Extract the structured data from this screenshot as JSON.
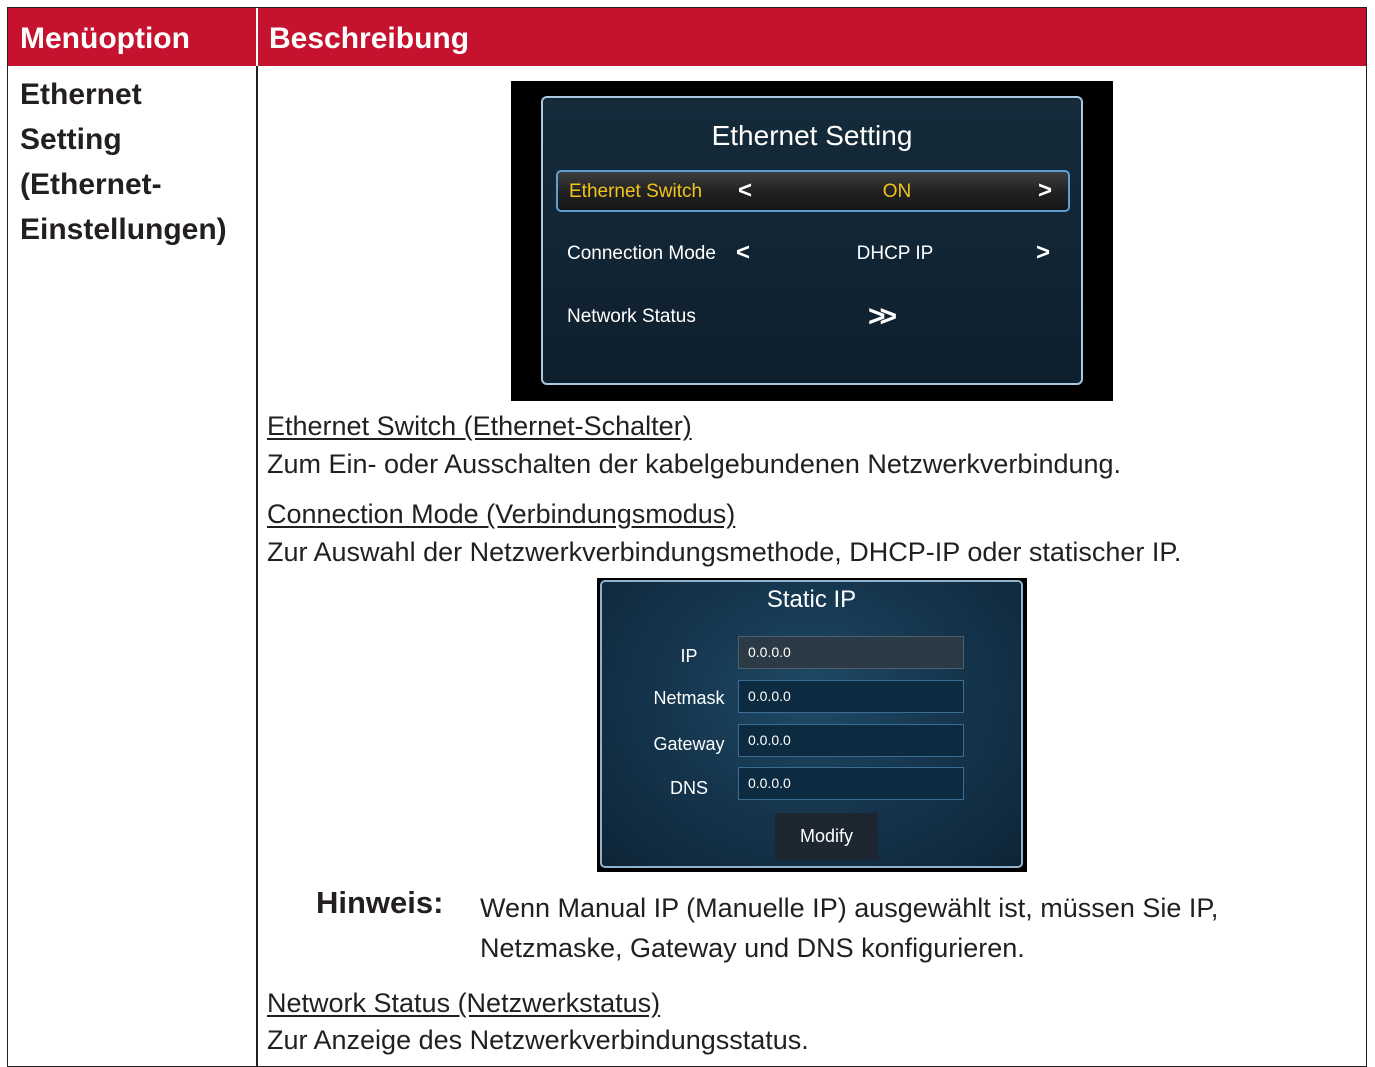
{
  "table": {
    "header": {
      "col1": "Menüoption",
      "col2": "Beschreibung"
    },
    "menu_option": {
      "line1": "Ethernet",
      "line2": "Setting",
      "line3": "(Ethernet-",
      "line4": "Einstellungen)"
    }
  },
  "ethernet_panel": {
    "title": "Ethernet Setting",
    "rows": [
      {
        "label": "Ethernet Switch",
        "value": "ON",
        "left": "<",
        "right": ">"
      },
      {
        "label": "Connection Mode",
        "value": "DHCP IP",
        "left": "<",
        "right": ">"
      },
      {
        "label": "Network Status",
        "value": ">>"
      }
    ]
  },
  "sections": {
    "ethernet_switch": {
      "title": "Ethernet Switch (Ethernet-Schalter)",
      "text": "Zum Ein- oder Ausschalten der kabelgebundenen Netzwerkverbindung."
    },
    "connection_mode": {
      "title": "Connection Mode (Verbindungsmodus)",
      "text": "Zur Auswahl der Netzwerkverbindungsmethode, DHCP-IP oder statischer IP."
    },
    "network_status": {
      "title": "Network Status (Netzwerkstatus)",
      "text": "Zur Anzeige des Netzwerkverbindungsstatus."
    }
  },
  "static_ip_panel": {
    "title": "Static IP",
    "fields": [
      {
        "label": "IP",
        "value": "0.0.0.0"
      },
      {
        "label": "Netmask",
        "value": "0.0.0.0"
      },
      {
        "label": "Gateway",
        "value": "0.0.0.0"
      },
      {
        "label": "DNS",
        "value": "0.0.0.0"
      }
    ],
    "button": "Modify"
  },
  "note": {
    "label": "Hinweis:",
    "text": "Wenn Manual IP (Manuelle IP) ausgewählt ist, müssen Sie IP, Netzmaske, Gateway und DNS konfigurieren."
  },
  "colors": {
    "header_bg": "#c4122f",
    "highlight_text": "#f2c31b",
    "panel_border": "#a9c9e2"
  }
}
